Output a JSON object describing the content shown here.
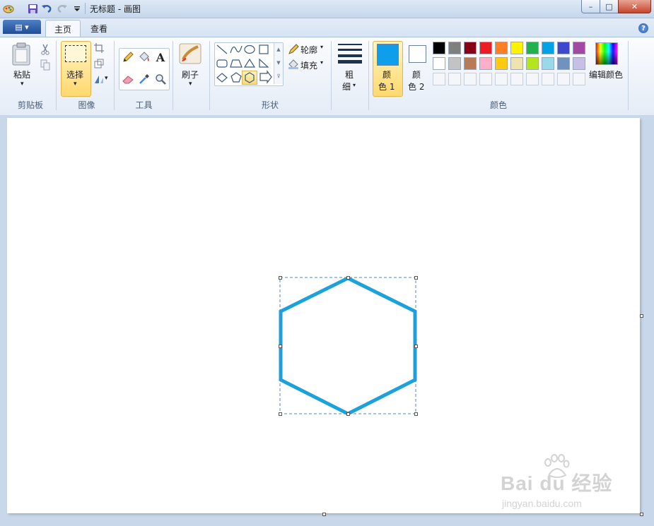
{
  "window": {
    "title": "无标题 - 画图",
    "controls": {
      "minimize": "–",
      "maximize": "□",
      "close": "✕"
    }
  },
  "quick_access": {
    "icons": [
      "paint-app-icon",
      "save-icon",
      "undo-icon",
      "redo-icon",
      "customize-dropdown-icon"
    ]
  },
  "tabs": {
    "file_label": "▤ ▾",
    "home": "主页",
    "view": "查看",
    "help": "?"
  },
  "ribbon": {
    "clipboard": {
      "group_label": "剪贴板",
      "paste": "粘贴",
      "paste_arrow": "▾"
    },
    "image": {
      "group_label": "图像",
      "select": "选择",
      "select_arrow": "▾",
      "rotate_arrow": "▾"
    },
    "tools": {
      "group_label": "工具",
      "text_tool": "A"
    },
    "brushes": {
      "label": "刷子",
      "arrow": "▾"
    },
    "shapes": {
      "group_label": "形状",
      "outline": "轮廓",
      "fill": "填充",
      "arrow": "▾",
      "selected_shape": "hexagon"
    },
    "size": {
      "label_1": "粗",
      "label_2": "细",
      "arrow": "▾"
    },
    "color1": {
      "label_1": "颜",
      "label_2": "色 1",
      "value": "#0f9fea"
    },
    "color2": {
      "label_1": "颜",
      "label_2": "色 2",
      "value": "#ffffff"
    },
    "colors": {
      "group_label": "颜色",
      "edit_label": "编辑颜色",
      "row1": [
        "#000000",
        "#7f7f7f",
        "#880015",
        "#ed1c24",
        "#ff7f27",
        "#fff200",
        "#22b14c",
        "#00a2e8",
        "#3f48cc",
        "#a349a4"
      ],
      "row2": [
        "#ffffff",
        "#c3c3c3",
        "#b97a57",
        "#ffaec9",
        "#ffc90e",
        "#efe4b0",
        "#b5e61d",
        "#99d9ea",
        "#7092be",
        "#c8bfe7"
      ]
    }
  },
  "canvas": {
    "shape_color": "#1ba1dc",
    "watermark_main": "Bai du 经验",
    "watermark_sub": "jingyan.baidu.com"
  }
}
